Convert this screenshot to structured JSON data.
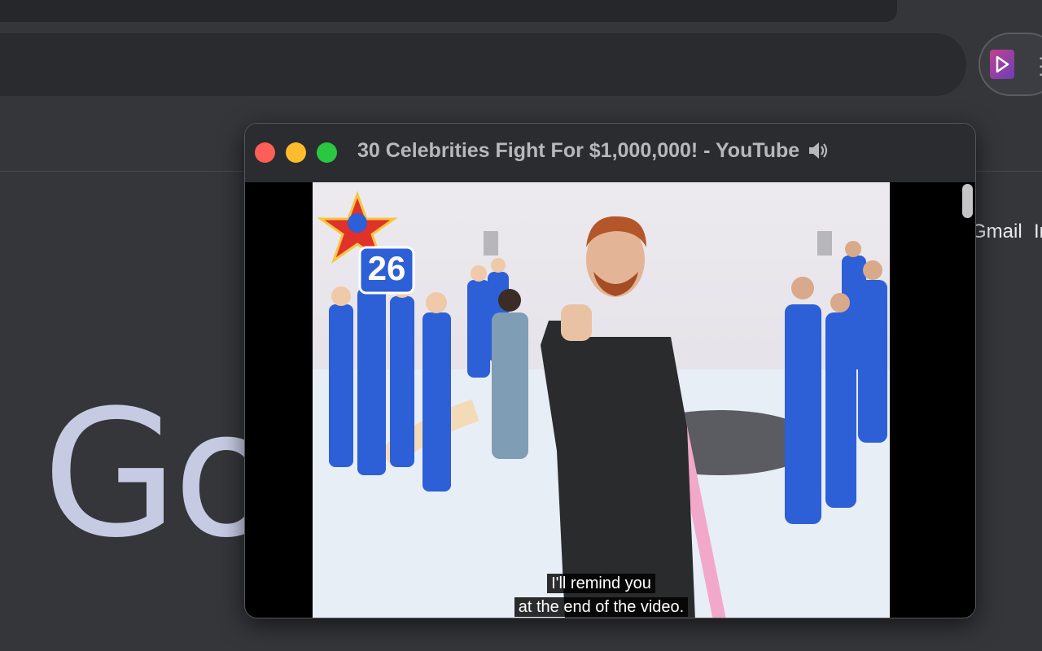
{
  "pip": {
    "title": "30 Celebrities Fight For $1,000,000! - YouTube",
    "audio_icon": "speaker-icon",
    "caption_line1": "I'll remind you",
    "caption_line2": "at the end of the video.",
    "badge_number": "26"
  },
  "google": {
    "logo_partial": "Goo"
  },
  "header": {
    "gmail": "Gmail",
    "images_partial": "Ir"
  },
  "colors": {
    "background": "#35363a",
    "pip_titlebar": "#2b2c30",
    "close": "#fe5f57",
    "minimize": "#fdbc2e",
    "maximize": "#29c840",
    "logo": "#c6cbe3",
    "suit_blue": "#2d5fd6"
  },
  "extension": {
    "icon": "play-extension-icon"
  }
}
